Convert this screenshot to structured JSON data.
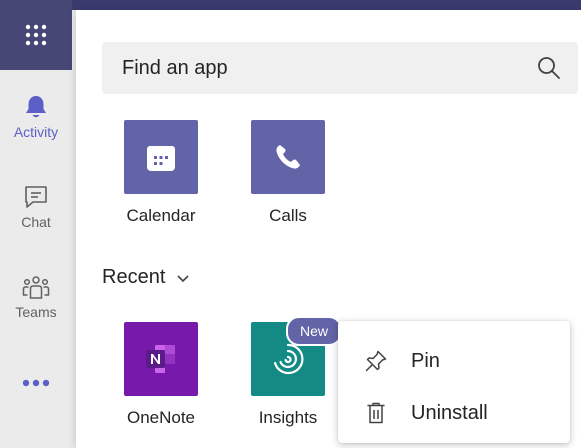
{
  "rail": {
    "items": [
      {
        "label": "Activity",
        "icon": "bell-icon"
      },
      {
        "label": "Chat",
        "icon": "chat-icon"
      },
      {
        "label": "Teams",
        "icon": "teams-icon"
      }
    ],
    "active_color": "#5b5fc7"
  },
  "search": {
    "placeholder": "Find an app"
  },
  "apps": [
    {
      "name": "Calendar",
      "icon": "calendar-icon",
      "color": "#6264a7"
    },
    {
      "name": "Calls",
      "icon": "phone-icon",
      "color": "#6264a7"
    }
  ],
  "recent": {
    "label": "Recent",
    "apps": [
      {
        "name": "OneNote",
        "icon": "onenote-icon",
        "color": "#7719aa"
      },
      {
        "name": "Insights",
        "icon": "insights-icon",
        "color": "#138a84",
        "badge": "New"
      }
    ]
  },
  "context_menu": {
    "items": [
      {
        "label": "Pin",
        "icon": "pin-icon"
      },
      {
        "label": "Uninstall",
        "icon": "trash-icon"
      }
    ]
  }
}
